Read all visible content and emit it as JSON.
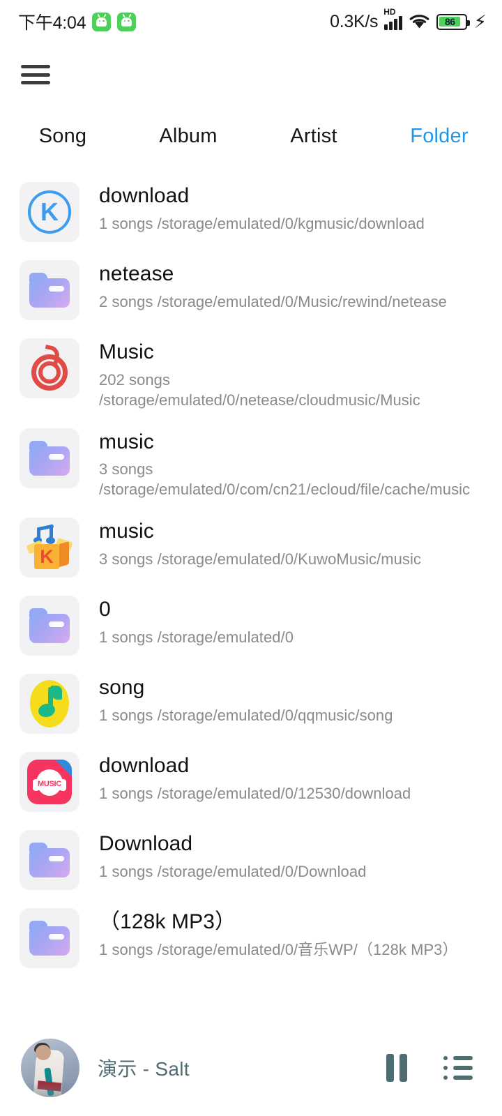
{
  "statusbar": {
    "time": "下午4:04",
    "app_icon_1": "android-robot-icon",
    "app_icon_2": "android-robot-icon",
    "network_speed": "0.3K/s",
    "hd_label": "HD",
    "signal_icon": "signal-bars-icon",
    "wifi_icon": "wifi-icon",
    "battery_level": "86",
    "battery_percent": 86,
    "charging_icon": "lightning-bolt-icon"
  },
  "topbar": {
    "menu_icon": "hamburger-menu-icon"
  },
  "tabs": [
    {
      "label": "Song",
      "active": false
    },
    {
      "label": "Album",
      "active": false
    },
    {
      "label": "Artist",
      "active": false
    },
    {
      "label": "Folder",
      "active": true
    }
  ],
  "colors": {
    "active_tab": "#2196e8",
    "thumb_background": "#f2f2f4",
    "folder_gradient_start": "#8fa8f6",
    "folder_gradient_end": "#d5aaf0",
    "kugou_blue": "#3d9bf0",
    "netease_red": "#e04b46",
    "kuwo_yellow": "#f9b233",
    "qqmusic_yellow": "#f5dd1e",
    "qqmusic_green": "#1bb98a",
    "music12530_pink": "#f5355f",
    "player_text": "#4f6c70",
    "title_text": "#111111",
    "subtitle_text": "#8a8a8a",
    "battery_green": "#4cd05a"
  },
  "folders": [
    {
      "icon": "kugou-app-icon",
      "name": "download",
      "count": "1 songs",
      "path": "/storage/emulated/0/kgmusic/download"
    },
    {
      "icon": "folder-icon",
      "name": "netease",
      "count": "2 songs",
      "path": "/storage/emulated/0/Music/rewind/netease"
    },
    {
      "icon": "netease-app-icon",
      "name": "Music",
      "count": "202 songs",
      "path": "/storage/emulated/0/netease/cloudmusic/Music"
    },
    {
      "icon": "folder-icon",
      "name": "music",
      "count": "3 songs",
      "path": "/storage/emulated/0/com/cn21/ecloud/file/cache/music"
    },
    {
      "icon": "kuwo-app-icon",
      "name": "music",
      "count": "3 songs",
      "path": "/storage/emulated/0/KuwoMusic/music"
    },
    {
      "icon": "folder-icon",
      "name": "0",
      "count": "1 songs",
      "path": "/storage/emulated/0"
    },
    {
      "icon": "qqmusic-app-icon",
      "name": "song",
      "count": "1 songs",
      "path": "/storage/emulated/0/qqmusic/song"
    },
    {
      "icon": "music12530-app-icon",
      "name": "download",
      "count": "1 songs",
      "path": "/storage/emulated/0/12530/download"
    },
    {
      "icon": "folder-icon",
      "name": "Download",
      "count": "1 songs",
      "path": "/storage/emulated/0/Download"
    },
    {
      "icon": "folder-icon",
      "name": "（128k MP3）",
      "count": "1 songs",
      "path": "/storage/emulated/0/音乐WP/（128k MP3）"
    }
  ],
  "player": {
    "album_art": "album-art-thumbnail",
    "now_playing": "演示 - Salt",
    "play_pause_icon": "pause-icon",
    "playlist_icon": "playlist-icon"
  }
}
